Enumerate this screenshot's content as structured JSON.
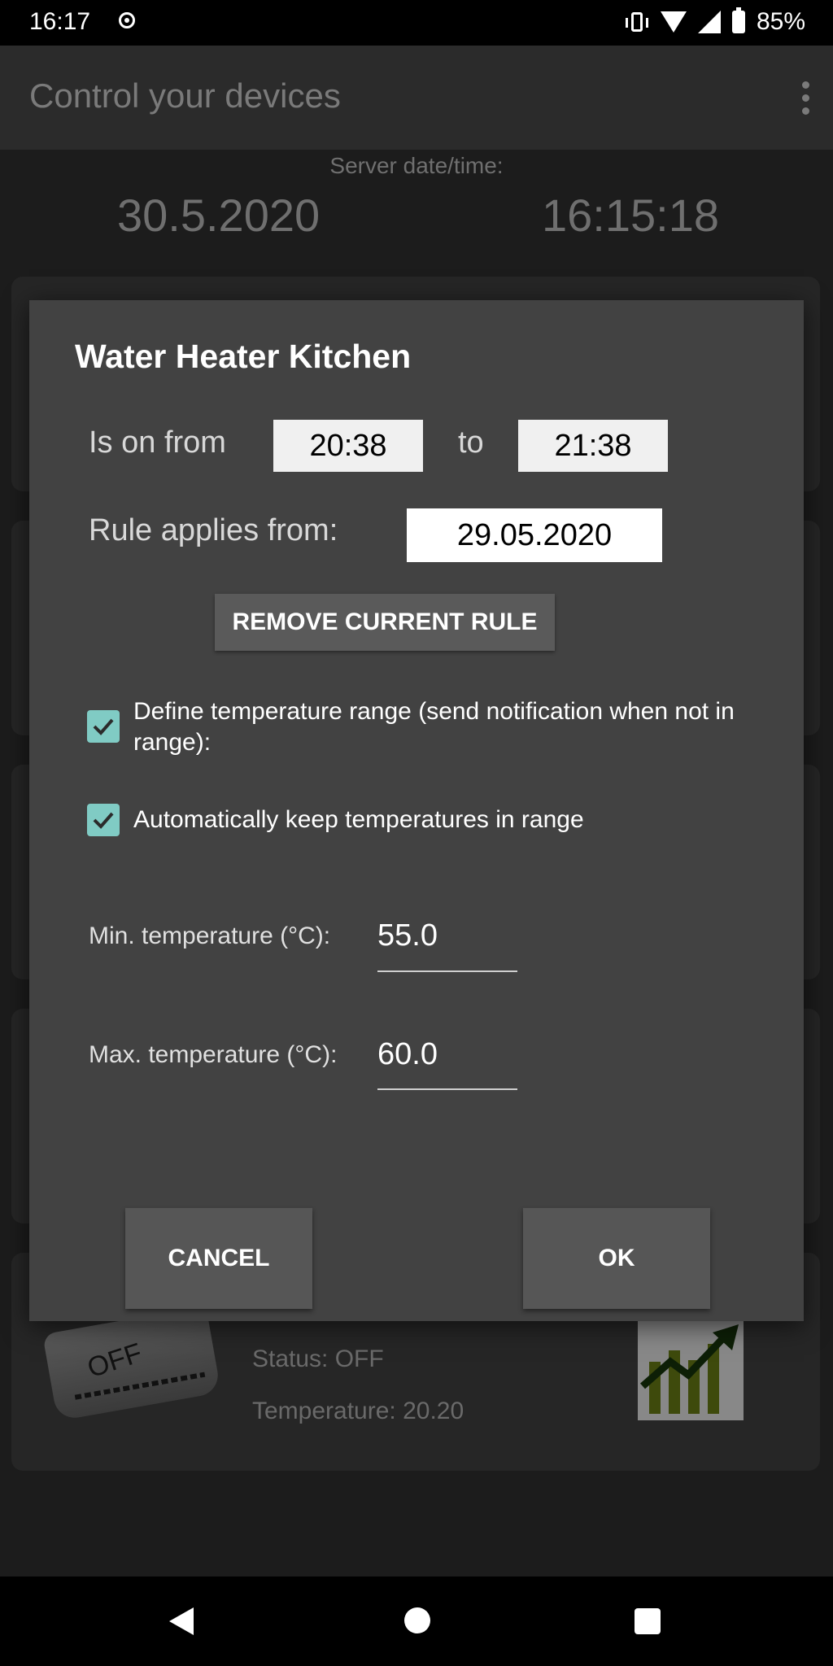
{
  "status_bar": {
    "time": "16:17",
    "battery": "85%"
  },
  "app_bar": {
    "title": "Control your devices"
  },
  "server": {
    "label": "Server date/time:",
    "date": "30.5.2020",
    "time": "16:15:18"
  },
  "device_card": {
    "ac_label": "OFF",
    "status": "Status: OFF",
    "temperature": "Temperature: 20.20"
  },
  "dialog": {
    "title": "Water Heater Kitchen",
    "is_on_from_label": "Is on from",
    "from_time": "20:38",
    "to_label": "to",
    "to_time": "21:38",
    "rule_applies_label": "Rule applies from:",
    "rule_date": "29.05.2020",
    "remove_button": "REMOVE CURRENT RULE",
    "define_range_label": "Define temperature range (send notification when not in range):",
    "define_range_checked": true,
    "auto_keep_label": "Automatically keep temperatures in range",
    "auto_keep_checked": true,
    "min_temp_label": "Min. temperature (°C):",
    "min_temp_value": "55.0",
    "max_temp_label": "Max. temperature (°C):",
    "max_temp_value": "60.0",
    "cancel_button": "CANCEL",
    "ok_button": "OK"
  },
  "colors": {
    "checkbox": "#80cbc4",
    "dialog_bg": "#424242",
    "status_bar": "#000000"
  }
}
